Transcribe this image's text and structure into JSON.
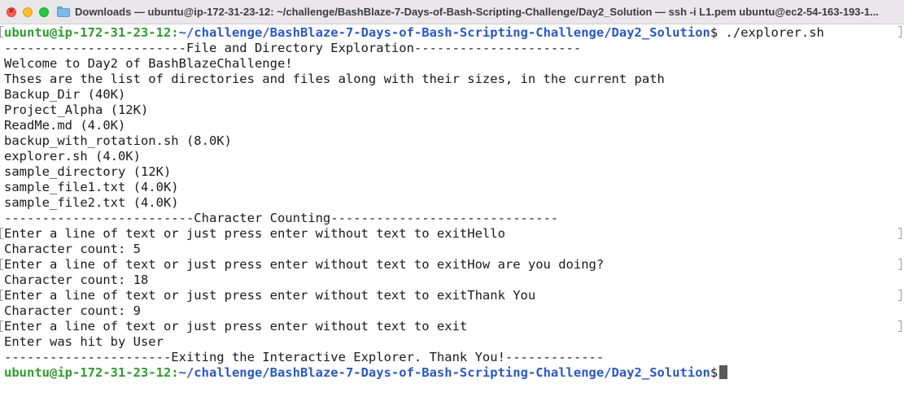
{
  "window": {
    "title": "Downloads — ubuntu@ip-172-31-23-12: ~/challenge/BashBlaze-7-Days-of-Bash-Scripting-Challenge/Day2_Solution — ssh -i L1.pem ubuntu@ec2-54-163-193-1..."
  },
  "prompt": {
    "user_host": "ubuntu@ip-172-31-23-12:",
    "path": "~/challenge/BashBlaze-7-Days-of-Bash-Scripting-Challenge/Day2_Solution",
    "symbol": "$",
    "command": " ./explorer.sh"
  },
  "output": {
    "lines": [
      "------------------------File and Directory Exploration----------------------",
      "Welcome to Day2 of BashBlazeChallenge!",
      "Thses are the list of directories and files along with their sizes, in the current path",
      "Backup_Dir (40K)",
      "Project_Alpha (12K)",
      "ReadMe.md (4.0K)",
      "backup_with_rotation.sh (8.0K)",
      "explorer.sh (4.0K)",
      "sample_directory (12K)",
      "sample_file1.txt (4.0K)",
      "sample_file2.txt (4.0K)",
      "-------------------------Character Counting------------------------------",
      "Enter a line of text or just press enter without text to exitHello",
      "Character count: 5",
      "Enter a line of text or just press enter without text to exitHow are you doing?",
      "Character count: 18",
      "Enter a line of text or just press enter without text to exitThank You",
      "Character count: 9",
      "Enter a line of text or just press enter without text to exit",
      "Enter was hit by User",
      "----------------------Exiting the Interactive Explorer. Thank You!-------------"
    ]
  },
  "icons": {
    "close": "close-icon",
    "minimize": "minimize-icon",
    "zoom": "zoom-icon",
    "folder": "folder-icon"
  }
}
